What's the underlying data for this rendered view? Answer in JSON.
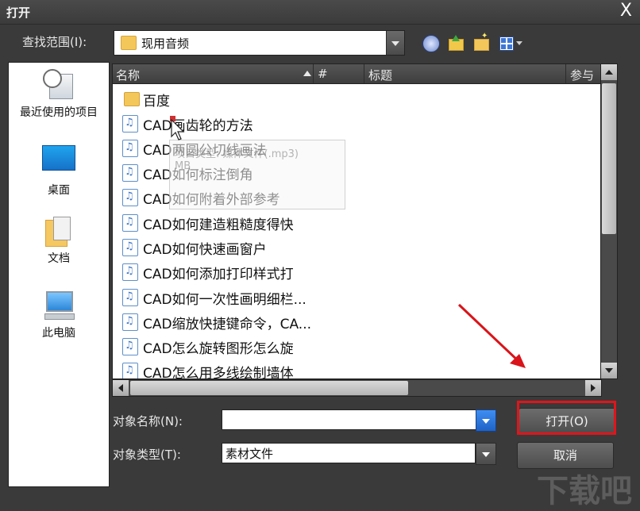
{
  "window": {
    "title": "打开",
    "close_glyph": "X"
  },
  "toolbar": {
    "look_in_label": "查找范围(I):",
    "current_folder": "现用音频",
    "icons": [
      "back-icon",
      "up-folder-icon",
      "new-folder-icon",
      "view-menu-icon"
    ]
  },
  "places": [
    {
      "label": "最近使用的项目",
      "icon": "recent-items-icon"
    },
    {
      "label": "桌面",
      "icon": "desktop-icon"
    },
    {
      "label": "文档",
      "icon": "documents-icon"
    },
    {
      "label": "此电脑",
      "icon": "computer-icon"
    }
  ],
  "columns": {
    "name": "名称",
    "number": "#",
    "title": "标题",
    "ref": "参与"
  },
  "files": [
    {
      "name": "百度",
      "type": "folder"
    },
    {
      "name": "CAD画齿轮的方法",
      "type": "audio"
    },
    {
      "name": "CAD两圆公切线画法",
      "type": "audio"
    },
    {
      "name": "CAD如何标注倒角",
      "type": "audio"
    },
    {
      "name": "CAD如何附着外部参考",
      "type": "audio"
    },
    {
      "name": "CAD如何建造粗糙度得快",
      "type": "audio"
    },
    {
      "name": "CAD如何快速画窗户",
      "type": "audio"
    },
    {
      "name": "CAD如何添加打印样式打",
      "type": "audio"
    },
    {
      "name": "CAD如何一次性画明细栏...",
      "type": "audio"
    },
    {
      "name": "CAD缩放快捷键命令，CA...",
      "type": "audio"
    },
    {
      "name": "CAD怎么旋转图形怎么旋",
      "type": "audio"
    },
    {
      "name": "CAD怎么用多线绘制墙体",
      "type": "audio"
    }
  ],
  "tooltip": {
    "text": "项目类型: 媒体文件(.mp3)\nMB"
  },
  "form": {
    "filename_label": "对象名称(N):",
    "filename_value": "",
    "filetype_label": "对象类型(T):",
    "filetype_value": "素材文件"
  },
  "buttons": {
    "open": "打开(O)",
    "cancel": "取消"
  },
  "colors": {
    "highlight": "#e0151b",
    "arrow": "#d9141a",
    "accent_drop": "#2f7ce0"
  },
  "watermark": "下载吧"
}
